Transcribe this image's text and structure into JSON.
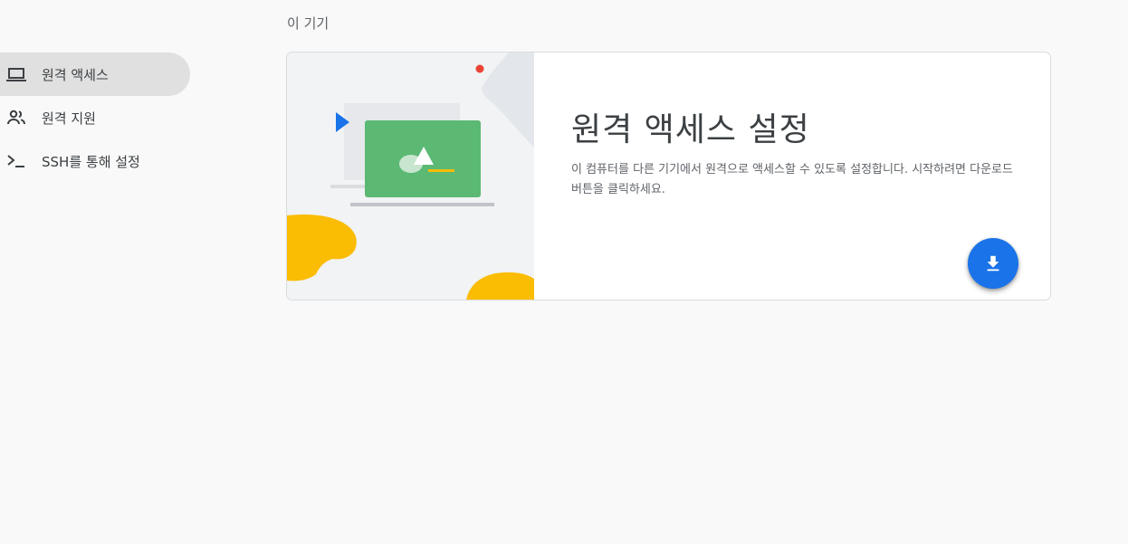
{
  "sidebar": {
    "items": [
      {
        "label": "원격 액세스",
        "icon": "laptop-icon",
        "active": true
      },
      {
        "label": "원격 지원",
        "icon": "people-icon",
        "active": false
      },
      {
        "label": "SSH를 통해 설정",
        "icon": "terminal-icon",
        "active": false
      }
    ]
  },
  "main": {
    "section_title": "이 기기",
    "card": {
      "title": "원격 액세스 설정",
      "description": "이 컴퓨터를 다른 기기에서 원격으로 액세스할 수 있도록 설정합니다. 시작하려면 다운로드 버튼을 클릭하세요.",
      "download_icon": "download-icon"
    }
  },
  "colors": {
    "accent": "#1a73e8",
    "active_nav": "#e0e0e0",
    "green": "#5bb974",
    "yellow": "#fbbc04",
    "red": "#ea4335"
  }
}
